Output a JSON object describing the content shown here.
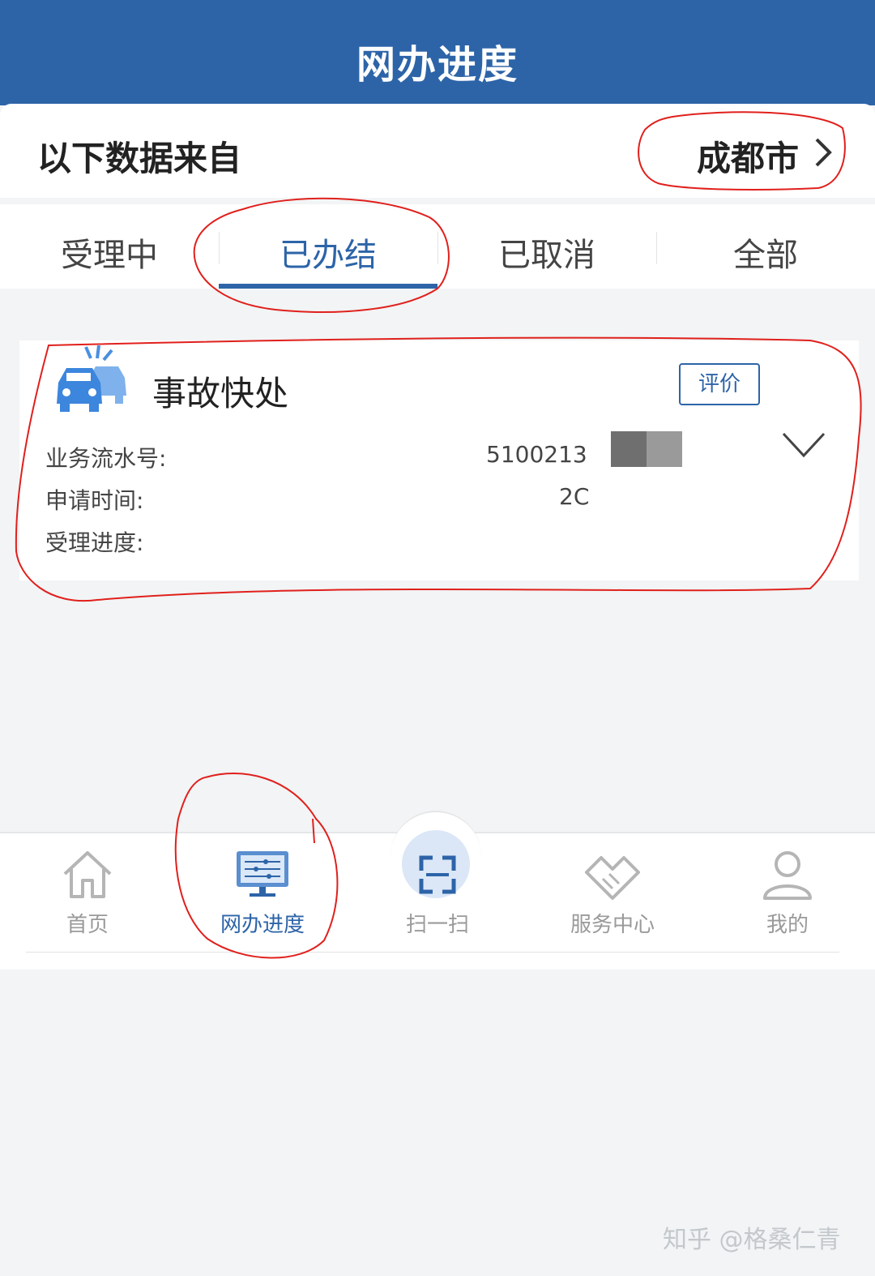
{
  "header": {
    "title": "网办进度"
  },
  "source": {
    "label": "以下数据来自",
    "city": "成都市"
  },
  "tabs": [
    {
      "label": "受理中"
    },
    {
      "label": "已办结"
    },
    {
      "label": "已取消"
    },
    {
      "label": "全部"
    }
  ],
  "active_tab": "已办结",
  "record": {
    "name": "事故快处",
    "rate_button": "评价",
    "fields": [
      {
        "label": "业务流水号:",
        "value": "5100213"
      },
      {
        "label": "申请时间:",
        "value": "2C"
      },
      {
        "label": "受理进度:",
        "value": ""
      }
    ]
  },
  "bottom_nav": [
    {
      "label": "首页",
      "icon": "home-icon"
    },
    {
      "label": "网办进度",
      "icon": "monitor-progress-icon"
    },
    {
      "label": "扫一扫",
      "icon": "scan-icon"
    },
    {
      "label": "服务中心",
      "icon": "handshake-icon"
    },
    {
      "label": "我的",
      "icon": "user-icon"
    }
  ],
  "watermark": "知乎 @格桑仁青",
  "colors": {
    "brand_blue": "#2d64a8",
    "annotation_red": "#e0201c"
  }
}
